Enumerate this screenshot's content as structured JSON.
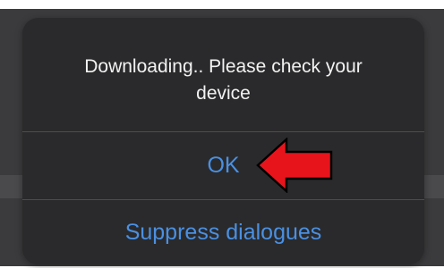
{
  "dialog": {
    "message": "Downloading.. Please check your device",
    "buttons": {
      "ok_label": "OK",
      "suppress_label": "Suppress dialogues"
    }
  },
  "annotation": {
    "arrow_icon": "red-left-arrow-icon",
    "color": "#e8141c"
  },
  "colors": {
    "dialog_bg": "#2a2a2c",
    "button_text": "#4a90e2",
    "message_text": "#f2f2f2"
  }
}
